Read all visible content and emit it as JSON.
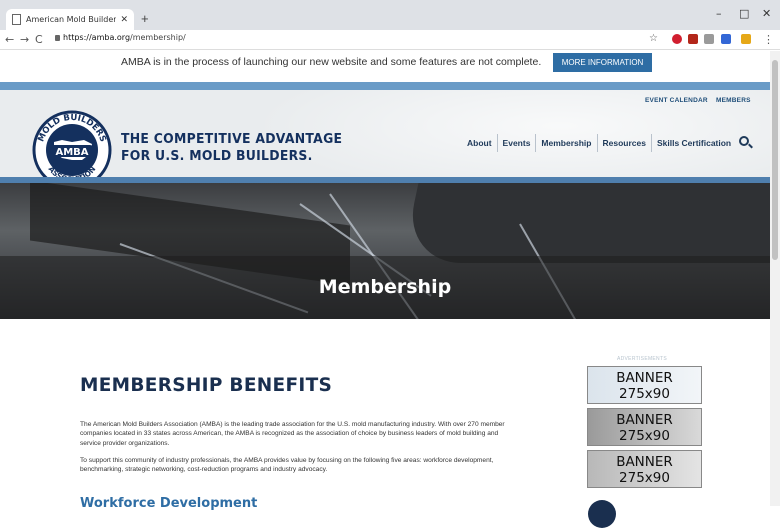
{
  "browser": {
    "tab_title": "American Mold Builders Associat",
    "new_tab": "+",
    "url_host": "https://amba.org",
    "url_path": "/membership/",
    "window_minimize": "–",
    "window_maximize": "□",
    "window_close": "✕",
    "back": "←",
    "forward": "→",
    "reload": "C",
    "star": "☆",
    "menu": "⋮"
  },
  "announcement": {
    "message": "AMBA is in the process of launching our new website and some features are not complete.",
    "button": "MORE INFORMATION"
  },
  "header": {
    "top_links": [
      "EVENT CALENDAR",
      "MEMBERS"
    ],
    "logo_text": "AMBA",
    "logo_ring_top": "MOLD BUILDERS",
    "logo_ring_left": "AMERICAN",
    "logo_ring_bottom": "ASSOCIATION",
    "tagline_line1": "THE COMPETITIVE ADVANTAGE",
    "tagline_line2": "FOR U.S. MOLD BUILDERS.",
    "nav": [
      "About",
      "Events",
      "Membership",
      "Resources",
      "Skills Certification"
    ]
  },
  "hero": {
    "title": "Membership"
  },
  "content": {
    "heading": "MEMBERSHIP BENEFITS",
    "para1": "The American Mold Builders Association (AMBA) is the leading trade association for the U.S. mold manufacturing industry. With over 270 member companies located in 33 states across American, the AMBA is recognized as the association of choice by business leaders of mold building and service provider organizations.",
    "para2": "To support this community of industry professionals, the AMBA provides value by focusing on the following five areas: workforce development, benchmarking, strategic networking, cost-reduction programs and industry advocacy.",
    "subheading": "Workforce Development"
  },
  "sidebar": {
    "ad_label": "ADVERTISEMENTS",
    "banners": [
      {
        "line1": "BANNER",
        "line2": "275x90"
      },
      {
        "line1": "BANNER",
        "line2": "275x90"
      },
      {
        "line1": "BANNER",
        "line2": "275x90"
      }
    ]
  },
  "colors": {
    "brand_navy": "#14305e",
    "brand_blue": "#2e6da4",
    "band_blue": "#6a9bc7"
  }
}
